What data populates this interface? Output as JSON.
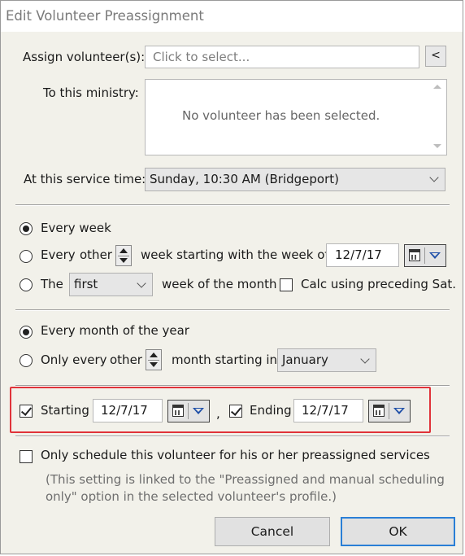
{
  "window": {
    "title": "Edit Volunteer Preassignment"
  },
  "assign": {
    "label": "Assign volunteer(s):",
    "placeholder": "Click to select...",
    "button_label": "<"
  },
  "ministry": {
    "label": "To this ministry:",
    "empty_text": "No volunteer has been selected."
  },
  "service_time": {
    "label": "At this service time:",
    "value": "Sunday, 10:30 AM (Bridgeport)"
  },
  "week_frequency": {
    "option_every_week": "Every week",
    "option_every": "Every",
    "other_text": "other",
    "week_starting_text": "week starting with the week of",
    "week_start_date": "12/7/17",
    "option_the": "The",
    "ordinal_value": "first",
    "week_of_month_text": "week of the month",
    "calc_label": "Calc using preceding Sat.",
    "selected": "every_week"
  },
  "month_frequency": {
    "option_every_month": "Every month of the year",
    "option_only_every": "Only every",
    "other_text": "other",
    "month_starting_text": "month starting in",
    "month_value": "January",
    "selected": "every_month"
  },
  "date_range": {
    "starting_label": "Starting",
    "starting_date": "12/7/17",
    "starting_checked": true,
    "comma": ",",
    "ending_label": "Ending",
    "ending_date": "12/7/17",
    "ending_checked": true
  },
  "preassigned_only": {
    "label": "Only schedule this volunteer for his or her preassigned services",
    "note_line1": "(This setting is linked to the \"Preassigned and manual scheduling",
    "note_line2": "only\" option in the selected volunteer's profile.)",
    "checked": false
  },
  "buttons": {
    "cancel": "Cancel",
    "ok": "OK"
  },
  "colors": {
    "highlight": "#e0333a",
    "default_button_border": "#2a7fd6",
    "dialog_bg": "#f2f1ea"
  }
}
